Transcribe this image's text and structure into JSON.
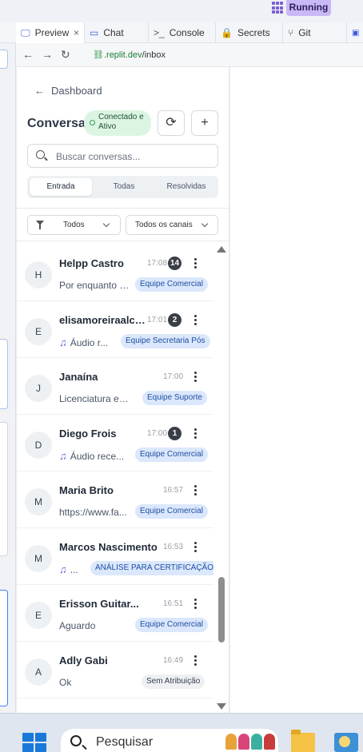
{
  "top": {
    "running_label": "Running"
  },
  "tabs": [
    {
      "label": "Preview",
      "icon": "monitor-icon",
      "close": "×"
    },
    {
      "label": "Chat",
      "icon": "chat-icon"
    },
    {
      "label": "Console",
      "icon": "terminal-icon"
    },
    {
      "label": "Secrets",
      "icon": "lock-icon"
    },
    {
      "label": "Git",
      "icon": "git-icon"
    }
  ],
  "browser": {
    "url_domain": ".replit.dev",
    "url_path": "/inbox"
  },
  "app": {
    "back_label": "Dashboard",
    "title": "Conversas",
    "status": "Conectado e Ativo",
    "search_placeholder": "Buscar conversas...",
    "segments": [
      "Entrada",
      "Todas",
      "Resolvidas"
    ],
    "filter_status": "Todos",
    "filter_channel": "Todos os canais"
  },
  "conversations": [
    {
      "initial": "H",
      "name": "Helpp Castro",
      "time": "17:08",
      "unread": "14",
      "preview": "Por enquanto s...",
      "audio": false,
      "tag": "Equipe Comercial",
      "tag_style": "blue"
    },
    {
      "initial": "E",
      "name": "elisamoreiraalca...",
      "time": "17:01",
      "unread": "2",
      "preview": "Áudio r...",
      "audio": true,
      "tag": "Equipe Secretaria Pós",
      "tag_style": "blue"
    },
    {
      "initial": "J",
      "name": "Janaína",
      "time": "17:00",
      "unread": "",
      "preview": "Licenciatura em ...",
      "audio": false,
      "tag": "Equipe Suporte",
      "tag_style": "blue"
    },
    {
      "initial": "D",
      "name": "Diego Frois",
      "time": "17:00",
      "unread": "1",
      "preview": "Áudio rece...",
      "audio": true,
      "tag": "Equipe Comercial",
      "tag_style": "blue"
    },
    {
      "initial": "M",
      "name": "Maria Brito",
      "time": "16:57",
      "unread": "",
      "preview": "https://www.fa...",
      "audio": false,
      "tag": "Equipe Comercial",
      "tag_style": "blue"
    },
    {
      "initial": "M",
      "name": "Marcos Nascimento",
      "time": "16:53",
      "unread": "",
      "preview": "...",
      "audio": true,
      "tag": "ANÁLISE PARA CERTIFICAÇÃO",
      "tag_style": "blue"
    },
    {
      "initial": "E",
      "name": "Erisson Guitar...",
      "time": "16:51",
      "unread": "",
      "preview": "Aguardo",
      "audio": false,
      "tag": "Equipe Comercial",
      "tag_style": "blue"
    },
    {
      "initial": "A",
      "name": "Adly Gabi",
      "time": "16:49",
      "unread": "",
      "preview": "Ok",
      "audio": false,
      "tag": "Sem Atribuição",
      "tag_style": "gray"
    }
  ],
  "taskbar": {
    "search_placeholder": "Pesquisar"
  },
  "colors": {
    "accent": "#5a67d8",
    "status_bg": "#dcf5e3",
    "tag_blue_bg": "#dbe7fb",
    "badge": "#3a3f47"
  }
}
